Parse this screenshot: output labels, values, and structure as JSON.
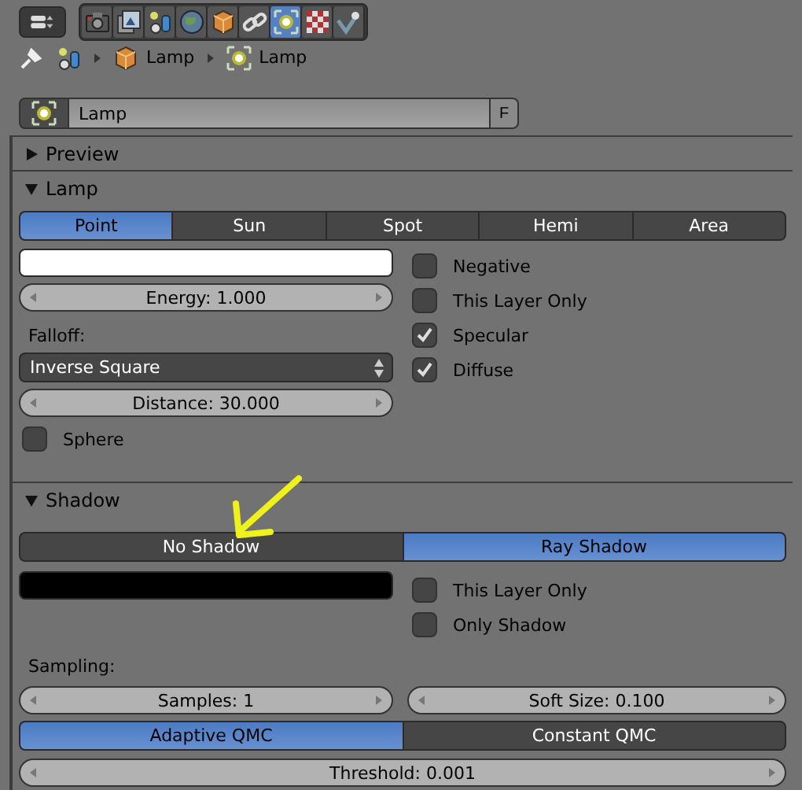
{
  "header": {
    "tabs": [
      {
        "kind": "render",
        "selected": false
      },
      {
        "kind": "layers",
        "selected": false
      },
      {
        "kind": "scene",
        "selected": false
      },
      {
        "kind": "world",
        "selected": false
      },
      {
        "kind": "object",
        "selected": false
      },
      {
        "kind": "constraints",
        "selected": false
      },
      {
        "kind": "lamp",
        "selected": true
      },
      {
        "kind": "texture",
        "selected": false
      },
      {
        "kind": "physics",
        "selected": false
      }
    ]
  },
  "breadcrumb": [
    {
      "kind": "scene"
    },
    {
      "kind": "object",
      "label": "Lamp"
    },
    {
      "kind": "lamp",
      "label": "Lamp"
    }
  ],
  "datablock": {
    "name": "Lamp",
    "fake_user": "F"
  },
  "preview": {
    "title": "Preview",
    "expanded": false
  },
  "lamp": {
    "title": "Lamp",
    "expanded": true,
    "types": [
      {
        "label": "Point",
        "selected": true
      },
      {
        "label": "Sun",
        "selected": false
      },
      {
        "label": "Spot",
        "selected": false
      },
      {
        "label": "Hemi",
        "selected": false
      },
      {
        "label": "Area",
        "selected": false
      }
    ],
    "color": "#ffffff",
    "energy": "Energy: 1.000",
    "falloff_label": "Falloff:",
    "falloff": "Inverse Square",
    "distance": "Distance: 30.000",
    "options": [
      {
        "label": "Negative",
        "checked": false
      },
      {
        "label": "This Layer Only",
        "checked": false
      },
      {
        "label": "Specular",
        "checked": true
      },
      {
        "label": "Diffuse",
        "checked": true
      }
    ],
    "sphere": {
      "label": "Sphere",
      "checked": false
    }
  },
  "shadow": {
    "title": "Shadow",
    "expanded": true,
    "types": [
      {
        "label": "No Shadow",
        "selected": false
      },
      {
        "label": "Ray Shadow",
        "selected": true
      }
    ],
    "color": "#000000",
    "options": [
      {
        "label": "This Layer Only",
        "checked": false
      },
      {
        "label": "Only Shadow",
        "checked": false
      }
    ],
    "sampling_label": "Sampling:",
    "samples": "Samples: 1",
    "soft_size": "Soft Size: 0.100",
    "methods": [
      {
        "label": "Adaptive QMC",
        "selected": true
      },
      {
        "label": "Constant QMC",
        "selected": false
      }
    ],
    "threshold": "Threshold: 0.001"
  }
}
